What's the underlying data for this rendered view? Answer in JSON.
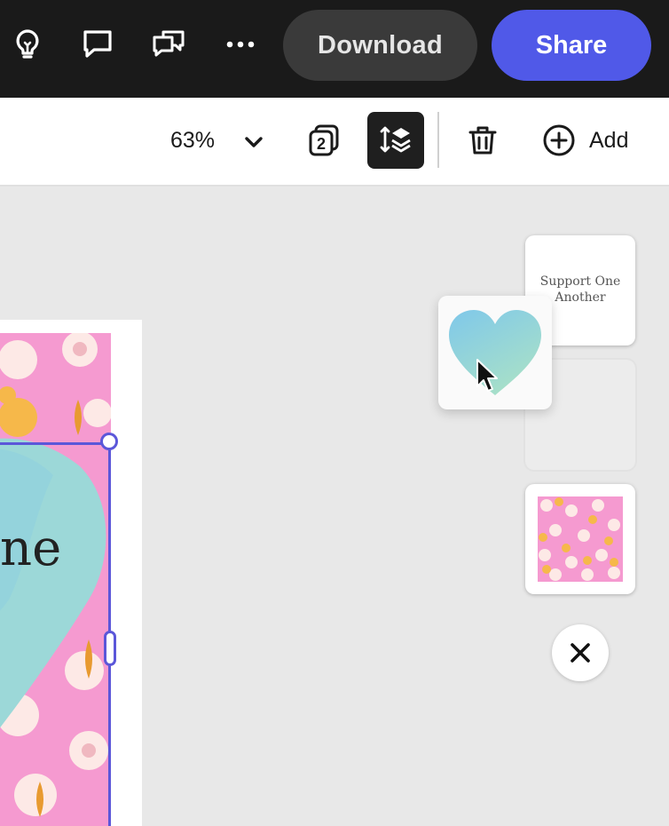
{
  "header": {
    "download_label": "Download",
    "share_label": "Share",
    "icons": [
      "lightbulb-icon",
      "comment-icon",
      "comments-icon",
      "more-icon"
    ],
    "share_color": "#5059e8"
  },
  "toolbar": {
    "zoom": "63%",
    "page_count": "2",
    "add_label": "Add",
    "icons": [
      "chevron-down-icon",
      "duplicate-page-icon",
      "reorder-layers-icon",
      "trash-icon",
      "plus-circle-icon"
    ]
  },
  "canvas": {
    "text_fragment": "ne"
  },
  "layers": {
    "items": [
      {
        "label": "Support One Another",
        "type": "text"
      },
      {
        "label": "",
        "type": "heart"
      },
      {
        "label": "",
        "type": "pattern"
      }
    ],
    "dragging": "heart",
    "close_icon": "close-icon"
  }
}
